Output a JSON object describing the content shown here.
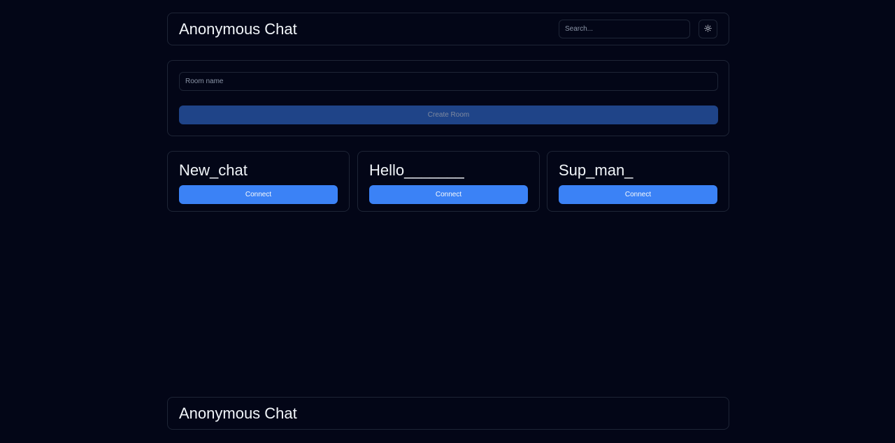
{
  "header": {
    "title": "Anonymous Chat",
    "search_placeholder": "Search...",
    "theme_icon": "sun-icon"
  },
  "create_room": {
    "input_placeholder": "Room name",
    "button_label": "Create Room"
  },
  "rooms": [
    {
      "name": "New_chat",
      "button_label": "Connect"
    },
    {
      "name": "Hello_______",
      "button_label": "Connect"
    },
    {
      "name": "Sup_man_",
      "button_label": "Connect"
    }
  ],
  "footer": {
    "title": "Anonymous Chat"
  },
  "colors": {
    "background": "#030617",
    "border": "#1e2536",
    "accent": "#3b82f6",
    "accent_disabled": "#1f4488"
  }
}
